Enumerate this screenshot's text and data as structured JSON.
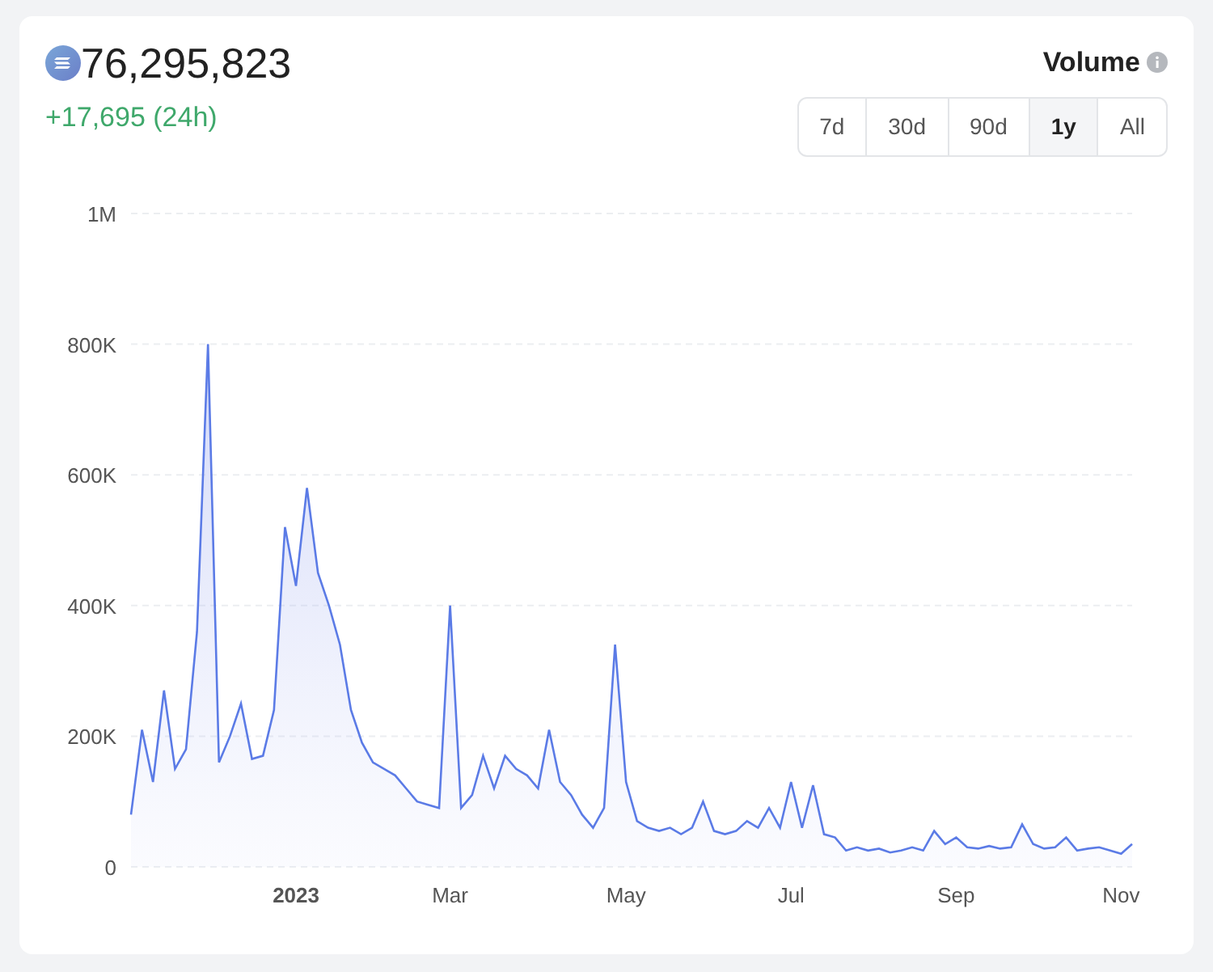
{
  "summary": {
    "total": "76,295,823",
    "change": "+17,695 (24h)"
  },
  "metric": {
    "title": "Volume"
  },
  "ranges": [
    {
      "label": "7d",
      "selected": false
    },
    {
      "label": "30d",
      "selected": false
    },
    {
      "label": "90d",
      "selected": false
    },
    {
      "label": "1y",
      "selected": true
    },
    {
      "label": "All",
      "selected": false
    }
  ],
  "chart_data": {
    "type": "area",
    "grid": true,
    "ylim": [
      0,
      1000000
    ],
    "categories": [
      null,
      null,
      null,
      null,
      null,
      null,
      null,
      null,
      null,
      null,
      null,
      null,
      null,
      null,
      null,
      "2023",
      null,
      null,
      null,
      null,
      null,
      null,
      null,
      null,
      null,
      null,
      null,
      null,
      null,
      "Mar",
      null,
      null,
      null,
      null,
      null,
      null,
      null,
      null,
      null,
      null,
      null,
      null,
      null,
      null,
      null,
      "May",
      null,
      null,
      null,
      null,
      null,
      null,
      null,
      null,
      null,
      null,
      null,
      null,
      null,
      null,
      "Jul",
      null,
      null,
      null,
      null,
      null,
      null,
      null,
      null,
      null,
      null,
      null,
      null,
      null,
      null,
      "Sep",
      null,
      null,
      null,
      null,
      null,
      null,
      null,
      null,
      null,
      null,
      null,
      null,
      null,
      null,
      "Nov",
      null
    ],
    "yticks": [
      {
        "value": 0,
        "label": "0"
      },
      {
        "value": 200000,
        "label": "200K"
      },
      {
        "value": 400000,
        "label": "400K"
      },
      {
        "value": 600000,
        "label": "600K"
      },
      {
        "value": 800000,
        "label": "800K"
      },
      {
        "value": 1000000,
        "label": "1M"
      }
    ],
    "series": [
      {
        "color": "#5b7be6",
        "values": [
          80000,
          210000,
          130000,
          270000,
          150000,
          180000,
          360000,
          800000,
          160000,
          200000,
          250000,
          165000,
          170000,
          240000,
          520000,
          430000,
          580000,
          450000,
          400000,
          340000,
          240000,
          190000,
          160000,
          150000,
          140000,
          120000,
          100000,
          95000,
          90000,
          400000,
          90000,
          110000,
          170000,
          120000,
          170000,
          150000,
          140000,
          120000,
          210000,
          130000,
          110000,
          80000,
          60000,
          90000,
          340000,
          130000,
          70000,
          60000,
          55000,
          60000,
          50000,
          60000,
          100000,
          55000,
          50000,
          55000,
          70000,
          60000,
          90000,
          60000,
          130000,
          60000,
          125000,
          50000,
          45000,
          25000,
          30000,
          25000,
          28000,
          22000,
          25000,
          30000,
          25000,
          55000,
          35000,
          45000,
          30000,
          28000,
          32000,
          28000,
          30000,
          65000,
          35000,
          28000,
          30000,
          45000,
          25000,
          28000,
          30000,
          25000,
          20000,
          35000
        ]
      }
    ]
  }
}
